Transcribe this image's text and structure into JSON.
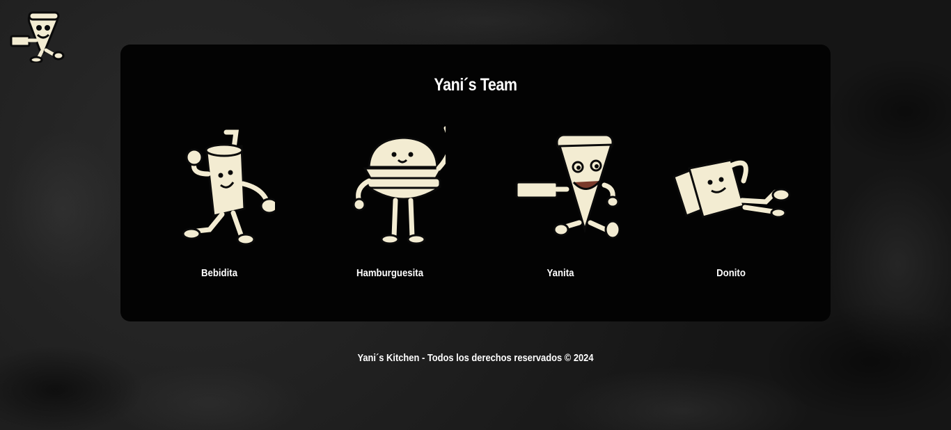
{
  "logo": {
    "icon": "pizza-mascot-icon"
  },
  "team": {
    "title": "Yani´s Team",
    "members": [
      {
        "name": "Bebidita",
        "icon": "drink-mascot-icon"
      },
      {
        "name": "Hamburguesita",
        "icon": "burger-mascot-icon"
      },
      {
        "name": "Yanita",
        "icon": "pizza-mascot-icon"
      },
      {
        "name": "Donito",
        "icon": "pizza-box-mascot-icon"
      }
    ]
  },
  "footer": {
    "text": "Yani´s Kitchen - Todos los derechos reservados © 2024"
  },
  "colors": {
    "card": "#030303",
    "cream": "#f3ecd2",
    "text": "#ffffff"
  }
}
